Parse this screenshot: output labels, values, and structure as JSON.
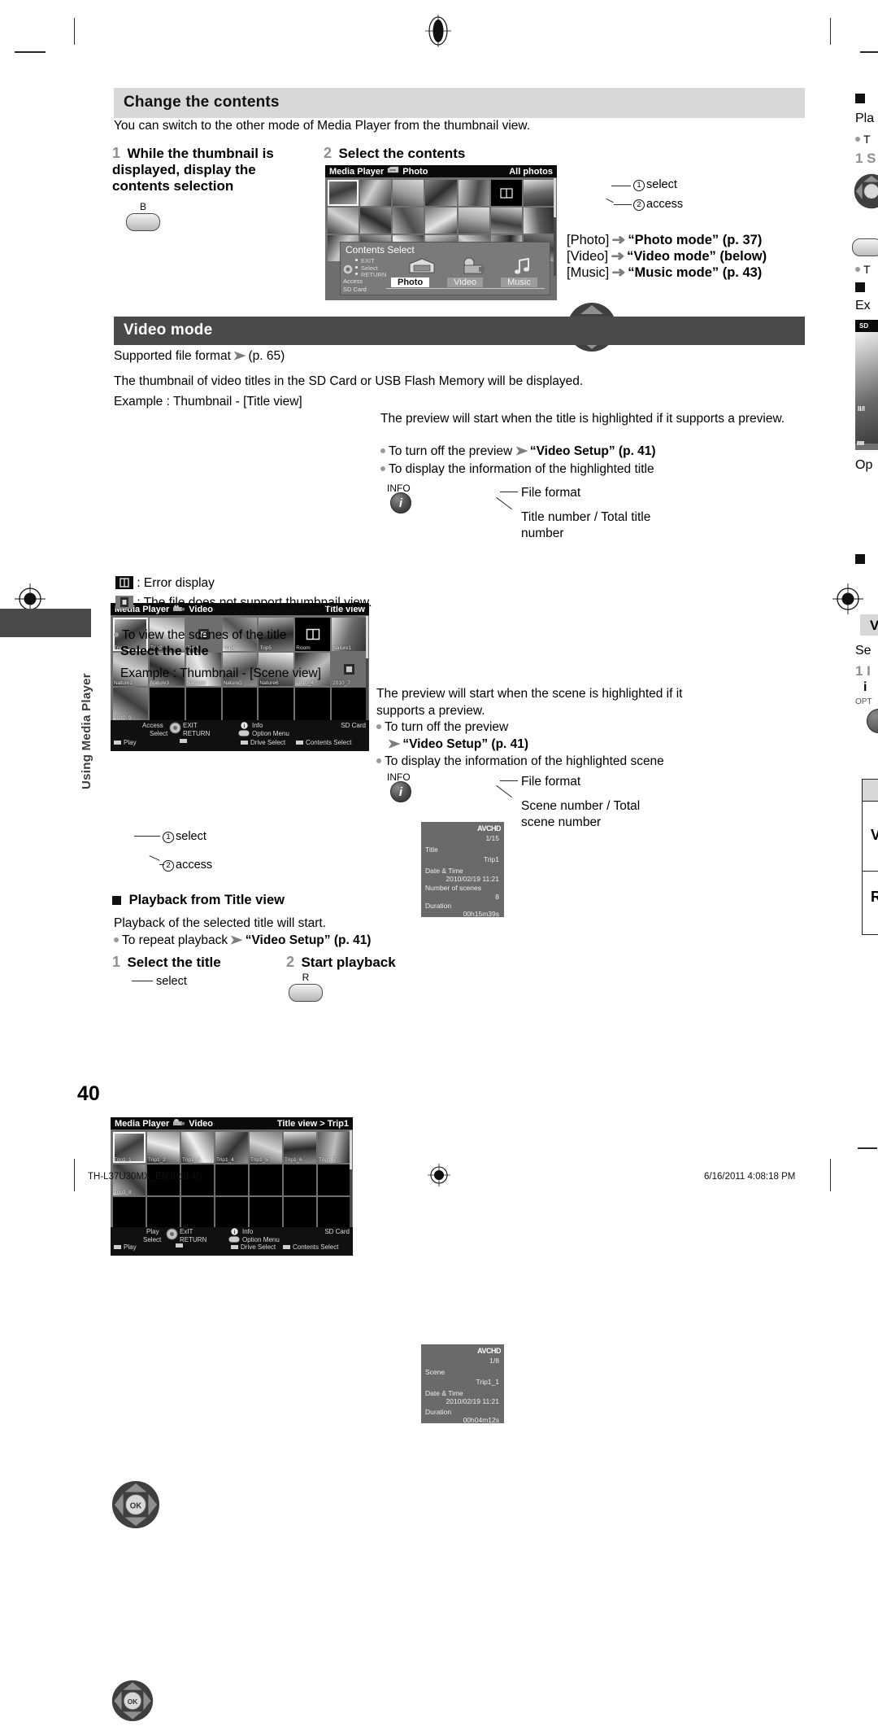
{
  "page": {
    "number": "40",
    "side_tab_label": "Using Media Player",
    "footer_left": "TH-L37U30MX_EN.indd   40",
    "footer_right": "6/16/2011   4:08:18 PM"
  },
  "section_change_contents": {
    "heading": "Change the contents",
    "intro": "You can switch to the other mode of Media Player from the thumbnail view.",
    "step1": {
      "num": "1",
      "title": "While the thumbnail is displayed, display the contents selection",
      "key_label": "B"
    },
    "step2": {
      "num": "2",
      "title": "Select the contents",
      "pad_note_1": "select",
      "pad_note_2": "access",
      "pad_num_1": "1",
      "pad_num_2": "2"
    },
    "mode_links": [
      {
        "bracket": "[Photo]",
        "arrow": "➜",
        "target": "“Photo mode” (p. 37)"
      },
      {
        "bracket": "[Video]",
        "arrow": "➜",
        "target": "“Video mode” (below)"
      },
      {
        "bracket": "[Music]",
        "arrow": "➜",
        "target": "“Music mode” (p. 43)"
      }
    ],
    "photo_screen": {
      "title": "Media Player",
      "mode": "Photo",
      "right_label": "All photos",
      "overlay_title": "Contents Select",
      "overlay_guides": [
        "EXIT",
        "Select",
        "RETURN"
      ],
      "overlay_access": "Access",
      "overlay_card": "SD Card",
      "tabs": [
        {
          "label": "Photo",
          "selected": true
        },
        {
          "label": "Video",
          "selected": false
        },
        {
          "label": "Music",
          "selected": false
        }
      ]
    }
  },
  "section_video_mode": {
    "heading": "Video mode",
    "supported_format": "Supported file format",
    "supported_format_ref": "(p. 65)",
    "thumbnail_note": "The thumbnail of video titles in the SD Card or USB Flash Memory will be displayed.",
    "example_title_view": "Example : Thumbnail - [Title view]",
    "preview_note_title": "The preview will start when the title is highlighted if it supports a preview.",
    "bullet_turn_off_preview": "To turn off the preview",
    "bullet_turn_off_preview_ref": "“Video Setup” (p. 41)",
    "bullet_display_info_title": "To display the information of the highlighted title",
    "icon_error_text": ": Error display",
    "icon_nothumb_text": ": The file does not support thumbnail view.",
    "bullet_view_scenes": "To view the scenes of the title",
    "select_the_title": "Select the title",
    "example_scene_view": "Example : Thumbnail - [Scene view]",
    "preview_note_scene": "The preview will start when the scene is highlighted if it supports a preview.",
    "bullet_turn_off_preview_scene": "To turn off the preview",
    "bullet_turn_off_preview_scene_ref": "“Video Setup” (p. 41)",
    "bullet_display_info_scene": "To display the information of the highlighted scene",
    "title_view_screen": {
      "title": "Media Player",
      "mode": "Video",
      "right_label": "Title view",
      "thumbs_row1": [
        "Trip1",
        "Trip2",
        "Trip3",
        "Trip4",
        "Trip5",
        "Room",
        "Nature1"
      ],
      "thumbs_row2": [
        "Nature2",
        "Nature3",
        "Nature4",
        "Nature5",
        "Nature6",
        "2010_4",
        "2010_7"
      ],
      "thumbs_row3": [
        "2010_9",
        "",
        "",
        "",
        "",
        "",
        ""
      ],
      "foot": {
        "access": "Access",
        "select": "Select",
        "exit": "EXIT",
        "return": "RETURN",
        "info": "Info",
        "option_menu": "Option Menu",
        "card": "SD Card",
        "play": "Play",
        "drive_select": "Drive Select",
        "contents_select": "Contents Select"
      }
    },
    "scene_view_screen": {
      "title": "Media Player",
      "mode": "Video",
      "right_label": "Title view  >  Trip1",
      "thumbs_row1": [
        "Trip1_1",
        "Trip1_2",
        "Trip1_3",
        "Trip1_4",
        "Trip1_5",
        "Trip1_6",
        "Trip1_7"
      ],
      "thumbs_row2": [
        "Trip1_8",
        "",
        "",
        "",
        "",
        "",
        ""
      ],
      "foot": {
        "play": "Play",
        "select": "Select",
        "exit": "ExIT",
        "return": "RETURN",
        "info": "Info",
        "option_menu": "Option Menu",
        "card": "SD Card",
        "play_key": "Play",
        "drive_select": "Drive Select",
        "contents_select": "Contents Select"
      }
    },
    "info_title": {
      "button_label": "INFO",
      "format": "AVCHD",
      "counter": "1/15",
      "rows": [
        {
          "label": "Title",
          "value": "Trip1"
        },
        {
          "label": "Date & Time",
          "value": "2010/02/19 11:21"
        },
        {
          "label": "Number of scenes",
          "value": "8"
        },
        {
          "label": "Duration",
          "value": "00h15m39s"
        }
      ],
      "callout_format": "File format",
      "callout_number": "Title number / Total title number"
    },
    "info_scene": {
      "button_label": "INFO",
      "format": "AVCHD",
      "counter": "1/8",
      "rows": [
        {
          "label": "Scene",
          "value": "Trip1_1"
        },
        {
          "label": "Date & Time",
          "value": "2010/02/19 11:21"
        },
        {
          "label": "Duration",
          "value": "00h04m12s"
        }
      ],
      "callout_format": "File format",
      "callout_number": "Scene number / Total scene number"
    },
    "scene_pad": {
      "num1": "1",
      "note1": "select",
      "num2": "2",
      "note2": "access"
    },
    "playback": {
      "heading": "Playback from Title view",
      "line": "Playback of the selected title will start.",
      "bullet_repeat": "To repeat playback",
      "bullet_repeat_ref": "“Video Setup” (p. 41)",
      "step1_num": "1",
      "step1_title": "Select the title",
      "step1_note": "select",
      "step2_num": "2",
      "step2_title": "Start playback",
      "step2_key": "R"
    }
  },
  "right_column_clipped": {
    "l1": "Pla",
    "l2": "T",
    "l3": "1 S",
    "l4": "T",
    "l5": "Ex",
    "l6": "SD",
    "l7": "II/I",
    "l8": "Op",
    "l9": "V",
    "l10": "Se",
    "l11": "1 I",
    "l12": "i",
    "l13": "OPT",
    "l14": "V",
    "l15": "R"
  },
  "colors": {
    "bar_light": "#d8d8d8",
    "bar_dark": "#4a4a4a",
    "tv_gray": "#6f6f6f",
    "tv_header": "#0a0a0a",
    "info_panel": "#6a6a6a",
    "step_num": "#8f8f8f"
  }
}
